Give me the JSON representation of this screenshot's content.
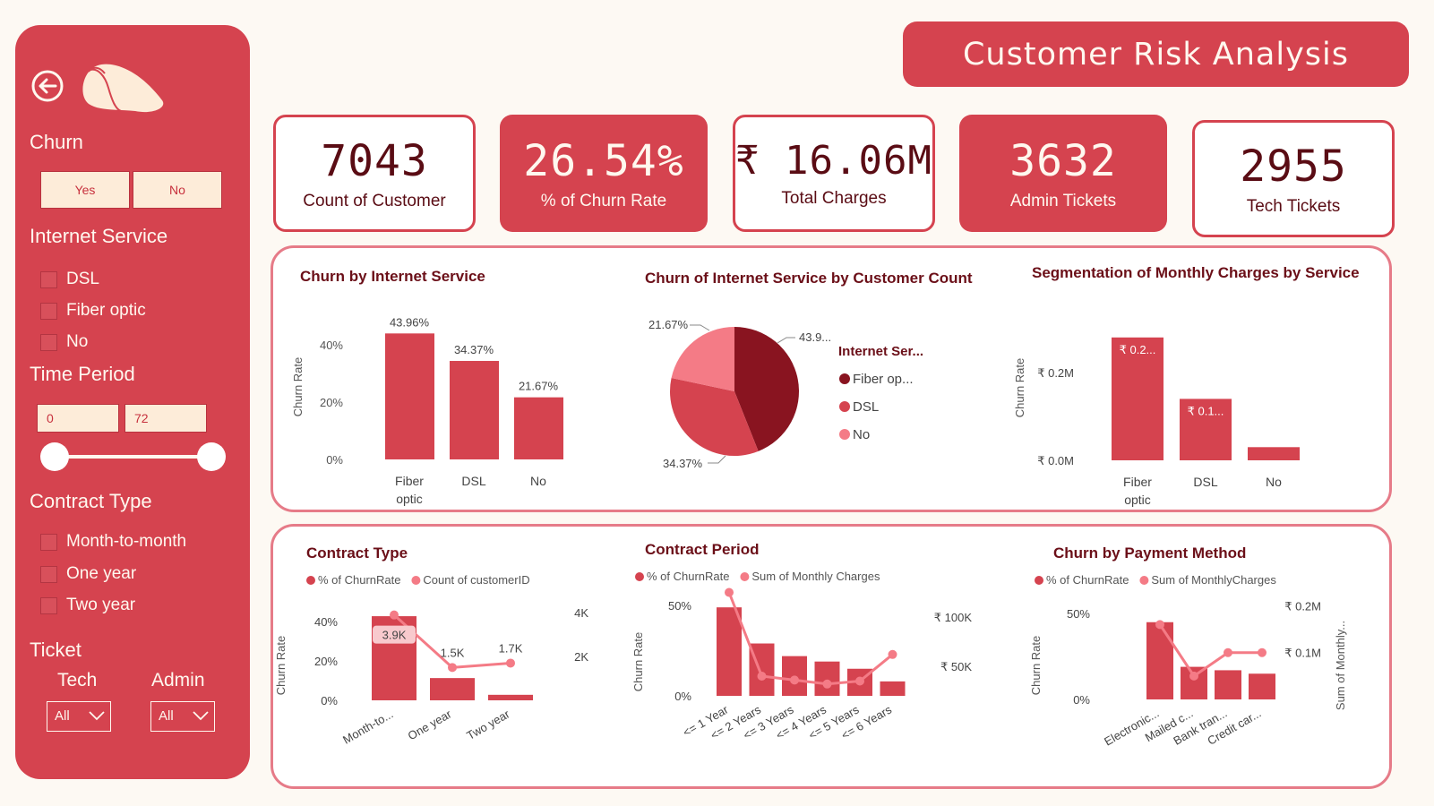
{
  "title": "Customer Risk Analysis",
  "sidebar": {
    "churn_label": "Churn",
    "churn_options": [
      "Yes",
      "No"
    ],
    "internet_label": "Internet Service",
    "internet_options": [
      "DSL",
      "Fiber optic",
      "No"
    ],
    "time_label": "Time Period",
    "time_min": "0",
    "time_max": "72",
    "contract_label": "Contract Type",
    "contract_options": [
      "Month-to-month",
      "One year",
      "Two year"
    ],
    "ticket_label": "Ticket",
    "tech_label": "Tech",
    "admin_label": "Admin",
    "tech_value": "All",
    "admin_value": "All"
  },
  "kpis": [
    {
      "value": "7043",
      "label": "Count of Customer"
    },
    {
      "value": "26.54%",
      "label": "% of Churn Rate"
    },
    {
      "value": "₹ 16.06M",
      "label": "Total Charges"
    },
    {
      "value": "3632",
      "label": "Admin Tickets"
    },
    {
      "value": "2955",
      "label": "Tech Tickets"
    }
  ],
  "colors": {
    "accent": "#d5434f",
    "dark": "#891420",
    "light": "#f47b86",
    "panel_border": "#e67b88"
  },
  "chart_data": [
    {
      "type": "bar",
      "title": "Churn by Internet Service",
      "ylabel": "Churn Rate",
      "categories": [
        "Fiber optic",
        "DSL",
        "No"
      ],
      "category_lines": [
        [
          "Fiber",
          "optic"
        ],
        [
          "DSL"
        ],
        [
          "No"
        ]
      ],
      "values": [
        43.96,
        34.37,
        21.67
      ],
      "data_labels": [
        "43.96%",
        "34.37%",
        "21.67%"
      ],
      "ylim": [
        0,
        50
      ],
      "yticks": [
        0,
        20,
        40
      ],
      "ytick_labels": [
        "0%",
        "20%",
        "40%"
      ]
    },
    {
      "type": "pie",
      "title": "Churn of Internet Service by Customer Count",
      "legend_title": "Internet Ser...",
      "labels": [
        "Fiber op...",
        "DSL",
        "No"
      ],
      "values": [
        43.96,
        34.37,
        21.67
      ],
      "data_labels": [
        "43.9...",
        "34.37%",
        "21.67%"
      ],
      "colors": [
        "#891420",
        "#d5434f",
        "#f47b86"
      ]
    },
    {
      "type": "bar",
      "title": "Segmentation of Monthly Charges by Service",
      "ylabel": "Churn Rate",
      "categories": [
        "Fiber optic",
        "DSL",
        "No"
      ],
      "category_lines": [
        [
          "Fiber",
          "optic"
        ],
        [
          "DSL"
        ],
        [
          "No"
        ]
      ],
      "values": [
        0.28,
        0.14,
        0.03
      ],
      "data_labels": [
        "₹ 0.2...",
        "₹ 0.1...",
        ""
      ],
      "ylim": [
        0,
        0.3
      ],
      "yticks": [
        0,
        0.2
      ],
      "ytick_labels": [
        "₹ 0.0M",
        "₹ 0.2M"
      ]
    },
    {
      "type": "bar",
      "title": "Contract Type",
      "ylabel": "Churn Rate",
      "legend": [
        "% of ChurnRate",
        "Count of customerID"
      ],
      "categories": [
        "Month-to...",
        "One year",
        "Two year"
      ],
      "series": [
        {
          "name": "% of ChurnRate",
          "values": [
            42.7,
            11.3,
            2.8
          ]
        },
        {
          "name": "Count of customerID",
          "values": [
            3900,
            1500,
            1700
          ]
        }
      ],
      "data_labels": [
        "3.9K",
        "1.5K",
        "1.7K"
      ],
      "ylim": [
        0,
        50
      ],
      "yticks": [
        0,
        20,
        40
      ],
      "ytick_labels": [
        "0%",
        "20%",
        "40%"
      ],
      "y2lim": [
        0,
        4500
      ],
      "y2ticks": [
        2000,
        4000
      ],
      "y2tick_labels": [
        "2K",
        "4K"
      ]
    },
    {
      "type": "bar",
      "title": "Contract Period",
      "ylabel": "Churn Rate",
      "legend": [
        "% of ChurnRate",
        "Sum of Monthly Charges"
      ],
      "categories": [
        "<= 1 Year",
        "<= 2 Years",
        "<= 3 Years",
        "<= 4 Years",
        "<= 5 Years",
        "<= 6 Years"
      ],
      "series": [
        {
          "name": "% of ChurnRate",
          "values": [
            49,
            29,
            22,
            19,
            15,
            8
          ]
        },
        {
          "name": "Sum of Monthly Charges",
          "values": [
            125000,
            40000,
            36000,
            32000,
            35000,
            62000
          ]
        }
      ],
      "ylim": [
        0,
        60
      ],
      "yticks": [
        0,
        50
      ],
      "ytick_labels": [
        "0%",
        "50%"
      ],
      "y2lim": [
        20000,
        130000
      ],
      "y2ticks": [
        50000,
        100000
      ],
      "y2tick_labels": [
        "₹ 50K",
        "₹ 100K"
      ]
    },
    {
      "type": "bar",
      "title": "Churn by Payment Method",
      "ylabel": "Churn Rate",
      "y2label": "Sum of Monthly...",
      "legend": [
        "% of ChurnRate",
        "Sum of MonthlyCharges"
      ],
      "categories": [
        "Electronic...",
        "Mailed c...",
        "Bank tran...",
        "Credit car..."
      ],
      "series": [
        {
          "name": "% of ChurnRate",
          "values": [
            45,
            19,
            17,
            15
          ]
        },
        {
          "name": "Sum of MonthlyCharges",
          "values": [
            0.16,
            0.05,
            0.1,
            0.1
          ]
        }
      ],
      "ylim": [
        0,
        60
      ],
      "yticks": [
        0,
        50
      ],
      "ytick_labels": [
        "0%",
        "50%"
      ],
      "y2lim": [
        0,
        0.22
      ],
      "y2ticks": [
        0.1,
        0.2
      ],
      "y2tick_labels": [
        "₹ 0.1M",
        "₹ 0.2M"
      ]
    }
  ]
}
